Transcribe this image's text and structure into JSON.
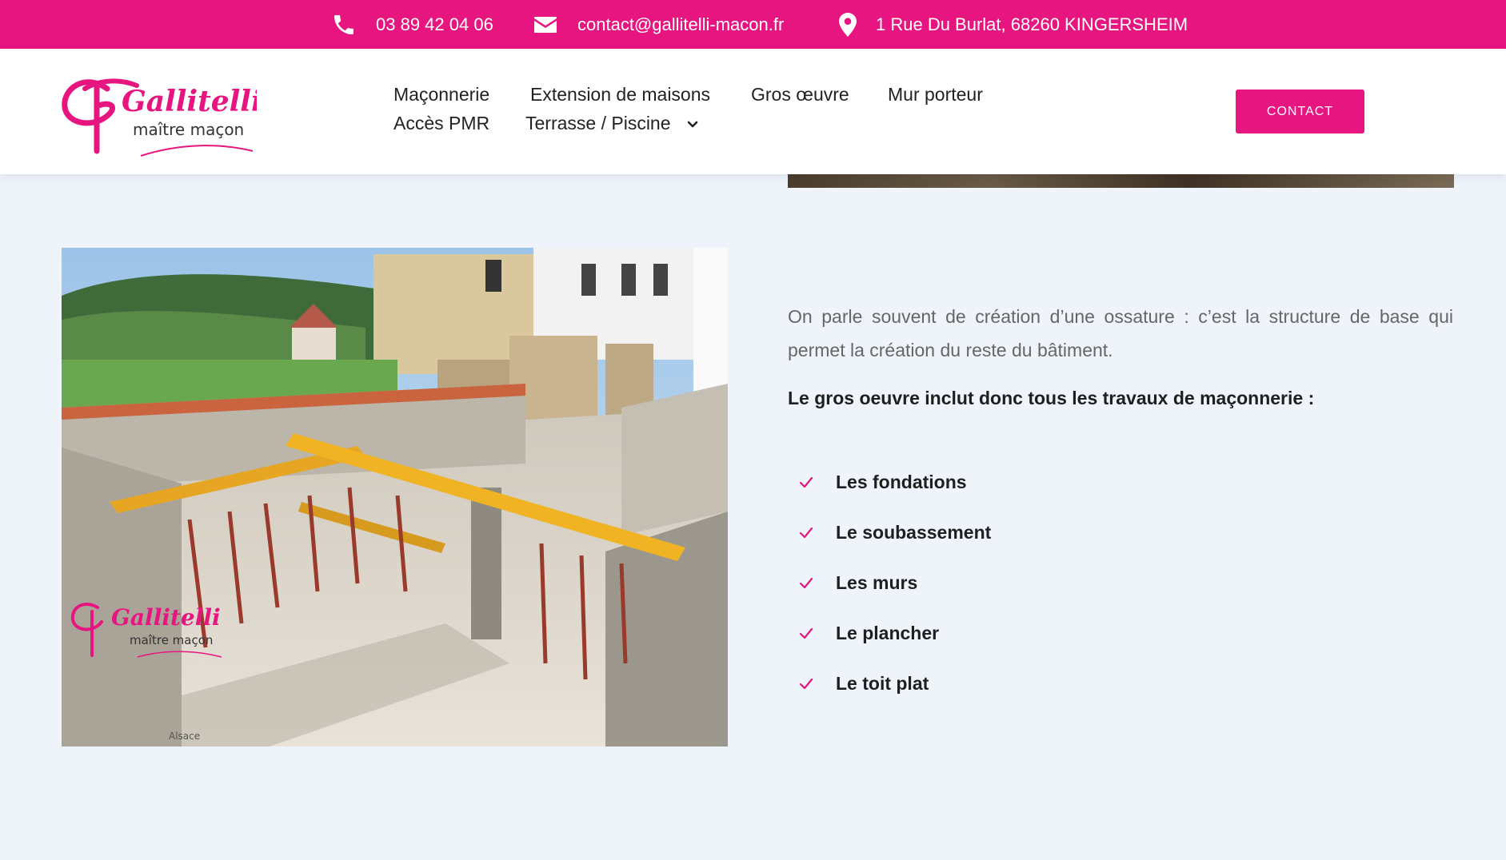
{
  "topbar": {
    "phone": "03 89 42 04 06",
    "email": "contact@gallitelli-macon.fr",
    "address": "1 Rue Du Burlat, 68260 KINGERSHEIM"
  },
  "logo": {
    "name": "Gallitelli",
    "tagline": "maître maçon"
  },
  "nav": {
    "items": [
      {
        "label": "Maçonnerie"
      },
      {
        "label": "Extension de maisons"
      },
      {
        "label": "Gros œuvre",
        "active": true
      },
      {
        "label": "Mur porteur"
      },
      {
        "label": "Accès PMR"
      },
      {
        "label": "Terrasse / Piscine"
      }
    ],
    "contact_label": "CONTACT"
  },
  "photo": {
    "watermark_name": "Gallitelli",
    "watermark_tagline": "maître maçon",
    "watermark_region": "Alsace"
  },
  "content": {
    "intro": "On parle souvent de création d’une ossature : c’est la structure de base qui permet la création du reste du bâtiment.",
    "lead": "Le gros oeuvre inclut donc tous les travaux de maçonnerie :",
    "checklist": [
      "Les fondations",
      "Le soubassement",
      "Les murs",
      "Le plancher",
      "Le toit plat"
    ]
  },
  "colors": {
    "brand": "#e6157f",
    "background": "#eef4fa",
    "text": "#1f1f1f",
    "muted": "#666666"
  },
  "icons": [
    "phone-icon",
    "envelope-icon",
    "map-pin-icon",
    "chevron-down-icon",
    "check-icon"
  ]
}
